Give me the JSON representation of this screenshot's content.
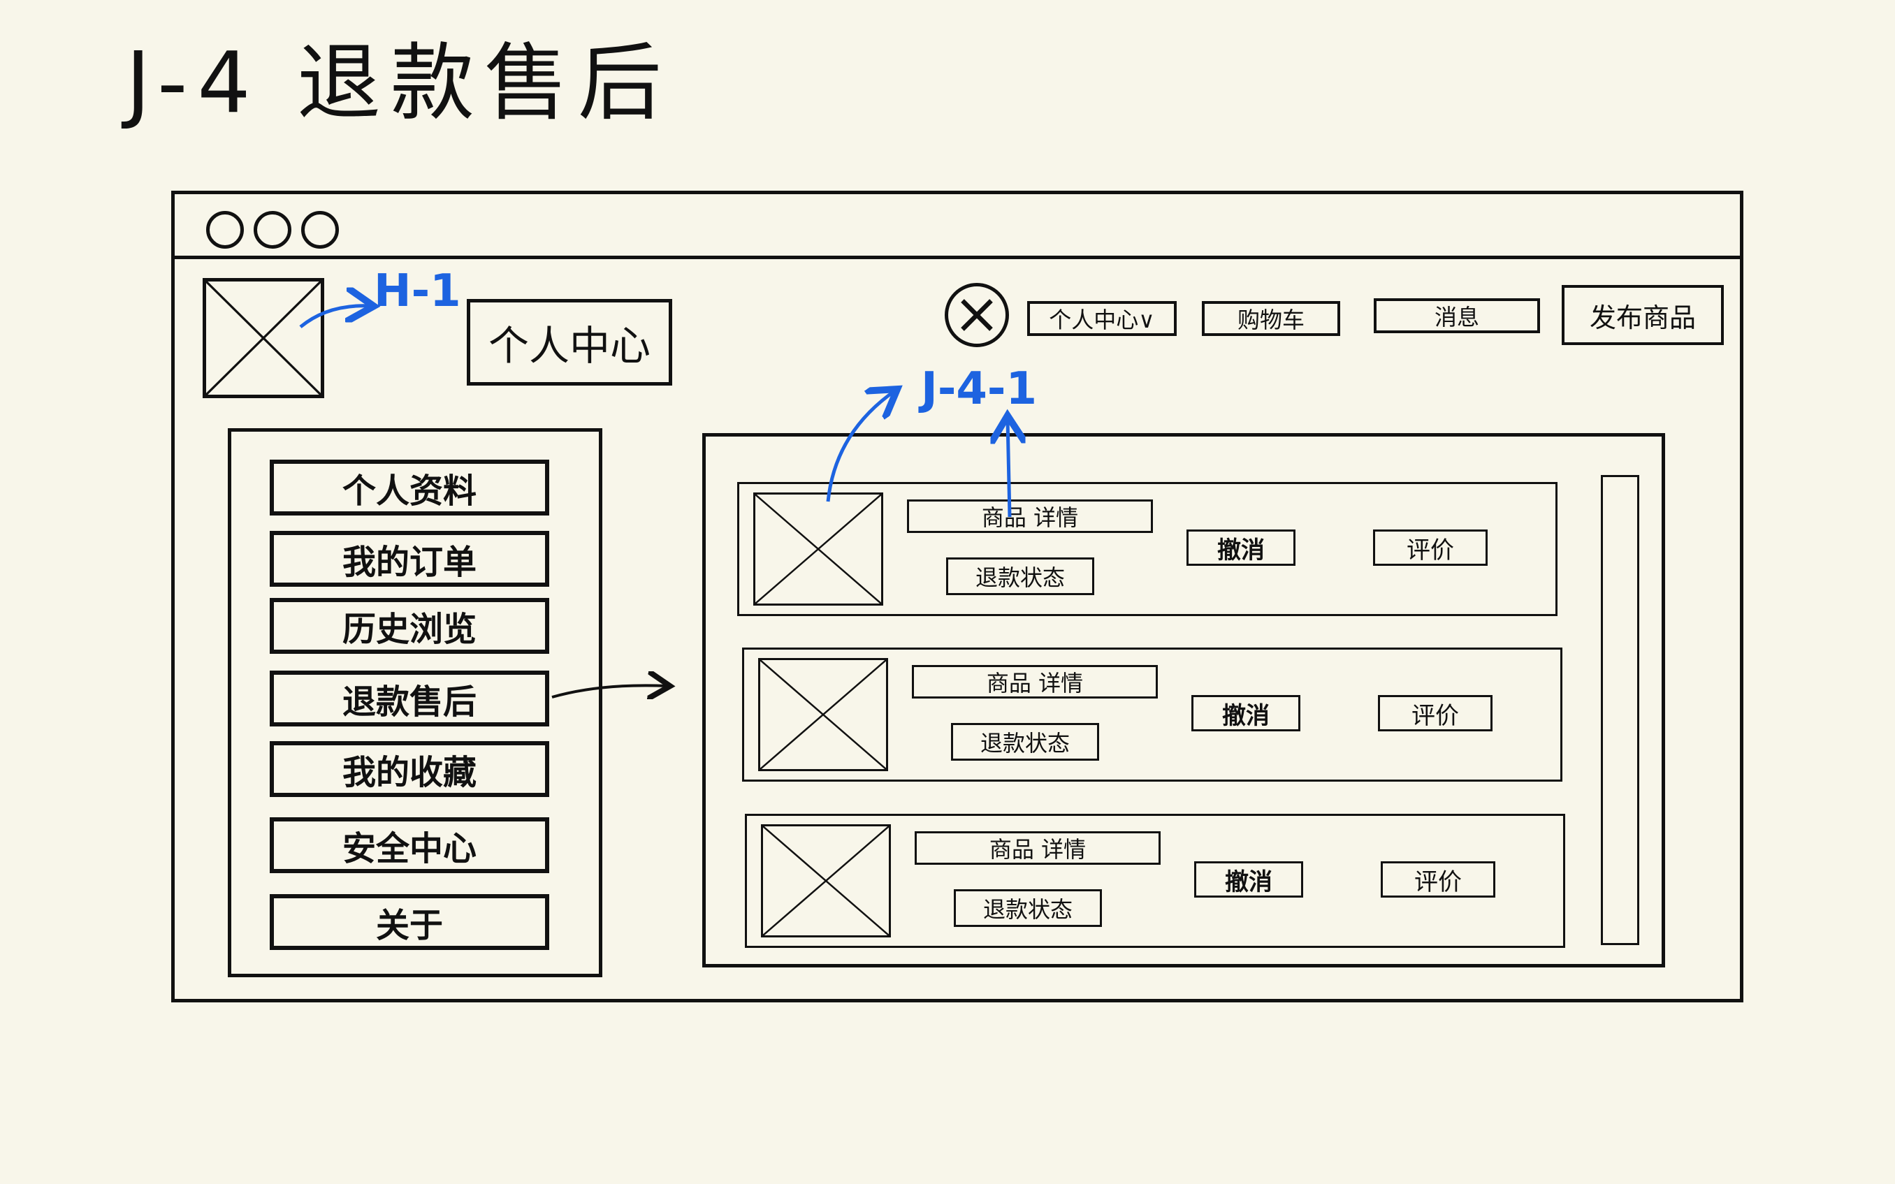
{
  "title": "J-4 退款售后",
  "header": {
    "page_name": "个人中心",
    "nav": [
      "个人中心∨",
      "购物车",
      "消息",
      "发布商品"
    ]
  },
  "sidebar": {
    "items": [
      "个人资料",
      "我的订单",
      "历史浏览",
      "退款售后",
      "我的收藏",
      "安全中心",
      "关于"
    ]
  },
  "orders": [
    {
      "detail": "商品 详情",
      "status": "退款状态",
      "cancel": "撤消",
      "review": "评价"
    },
    {
      "detail": "商品 详情",
      "status": "退款状态",
      "cancel": "撤消",
      "review": "评价"
    },
    {
      "detail": "商品 详情",
      "status": "退款状态",
      "cancel": "撤消",
      "review": "评价"
    }
  ],
  "annotations": {
    "logo_link": "H-1",
    "product_link": "J-4-1"
  },
  "colors": {
    "background": "#f8f6ea",
    "ink": "#111111",
    "annotation": "#1d63e0"
  }
}
